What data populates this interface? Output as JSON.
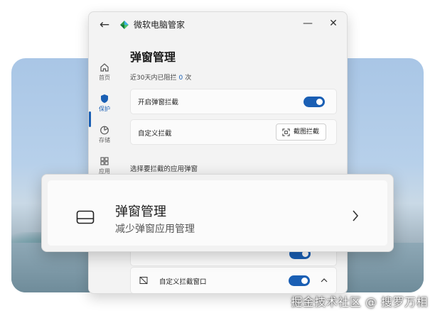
{
  "window": {
    "title": "微软电脑管家",
    "back_icon": "back-arrow-icon",
    "minimize_icon": "minimize-icon",
    "close_icon": "close-icon"
  },
  "nav": {
    "items": [
      {
        "label": "首页",
        "icon": "home-icon"
      },
      {
        "label": "保护",
        "icon": "shield-icon",
        "active": true
      },
      {
        "label": "存储",
        "icon": "pie-chart-icon"
      },
      {
        "label": "应用",
        "icon": "apps-grid-icon"
      }
    ]
  },
  "page": {
    "title": "弹窗管理",
    "stat_prefix": "近30天内已阻拦",
    "stat_count": "0",
    "stat_suffix": "次",
    "enable_label": "开启弹窗拦截",
    "enable_on": true,
    "custom_label": "自定义拦截",
    "screenshot_button": "截图拦截",
    "section_title": "选择要拦截的应用弹窗",
    "custom_window_label": "自定义拦截窗口",
    "custom_window_on": true
  },
  "popup": {
    "title": "弹窗管理",
    "subtitle": "减少弹窗应用管理",
    "icon": "window-icon",
    "chevron": "chevron-right-icon"
  },
  "watermark": "掘金技术社区 @ 搜罗万相",
  "colors": {
    "accent": "#1a5fb4",
    "window_bg": "#f3f3f3",
    "card_bg": "#fbfbfb"
  }
}
